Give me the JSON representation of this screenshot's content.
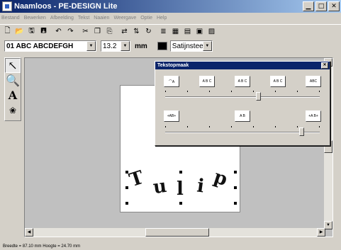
{
  "window": {
    "title": "Naamloos - PE-DESIGN Lite"
  },
  "menu": [
    "Bestand",
    "Bewerken",
    "Afbeelding",
    "Tekst",
    "Naaien",
    "Weergave",
    "Optie",
    "Help"
  ],
  "toolbar2": {
    "font_value": "01 ABC ABCDEFGH",
    "size_value": "13.2",
    "unit_label": "mm",
    "stitch_value": "Satijnsteek"
  },
  "tools": [
    "select-tool",
    "zoom-tool",
    "text-tool",
    "stamp-tool"
  ],
  "panel": {
    "title": "Tekstopmaak",
    "row1_buttons": [
      "A B C (arch up)",
      "A B C (slant)",
      "A B C",
      "A B C (wave)",
      "A B C (circle)"
    ],
    "row1_labels": [
      "⌒A",
      "A B C",
      "A B C",
      "A B C",
      "ABC"
    ],
    "row2_labels": [
      "+AB+",
      "A B",
      "+A B+"
    ],
    "spacing_fraction": 0.6,
    "width_fraction": 0.88
  },
  "design": {
    "letters": [
      "T",
      "u",
      "l",
      "i",
      "p"
    ]
  },
  "status": {
    "text": "Breedte = 87.10 mm  Hoogte = 24.70 mm"
  }
}
